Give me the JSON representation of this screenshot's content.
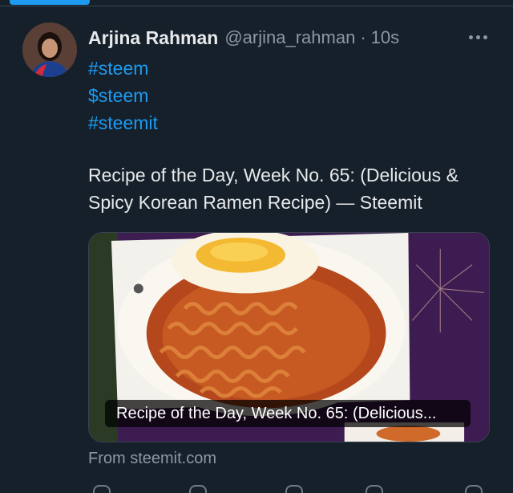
{
  "tweet": {
    "display_name": "Arjina Rahman",
    "handle": "@arjina_rahman",
    "separator": "·",
    "time": "10s",
    "hashtags": [
      "#steem",
      "$steem",
      "#steemit"
    ],
    "text": "Recipe of the Day, Week No. 65: (Delicious & Spicy Korean Ramen Recipe) — Steemit"
  },
  "card": {
    "title": "Recipe of the Day, Week No. 65: (Delicious...",
    "source": "From steemit.com"
  },
  "icons": {
    "more": "more-horizontal-icon",
    "reply": "reply-icon",
    "retweet": "retweet-icon",
    "like": "like-icon",
    "views": "views-icon",
    "share": "share-icon"
  },
  "colors": {
    "background": "#15202b",
    "accent": "#1d9bf0",
    "secondary_text": "#8b98a5",
    "primary_text": "#e7e9ea",
    "border": "#38444d"
  }
}
